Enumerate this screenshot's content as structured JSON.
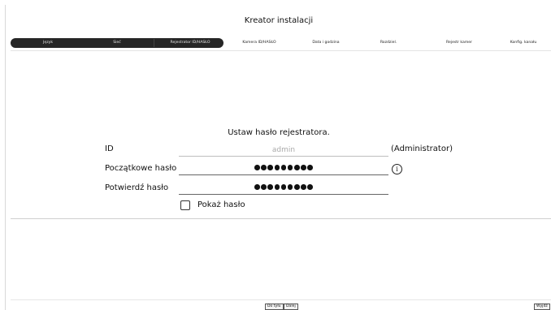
{
  "window": {
    "title": "Kreator instalacji"
  },
  "steps": [
    {
      "label": "Język",
      "state": "done"
    },
    {
      "label": "Sieć",
      "state": "done"
    },
    {
      "label": "Rejestrator ID/HASŁO",
      "state": "current"
    },
    {
      "label": "Kamera ID/HASŁO",
      "state": "todo"
    },
    {
      "label": "Data i godzina",
      "state": "todo"
    },
    {
      "label": "Rozdziel.",
      "state": "todo"
    },
    {
      "label": "Rejestr kamer",
      "state": "todo"
    },
    {
      "label": "Konfig. kanału",
      "state": "todo"
    }
  ],
  "form": {
    "heading": "Ustaw hasło rejestratora.",
    "id_label": "ID",
    "id_value": "admin",
    "id_note": "(Administrator)",
    "initial_password_label": "Początkowe hasło",
    "confirm_password_label": "Potwierdź hasło",
    "show_password_label": "Pokaż hasło",
    "show_password_checked": false,
    "masked_length": 9
  },
  "footer": {
    "back_label": "Do tyłu",
    "next_label": "Dalej",
    "exit_label": "Wyjdź"
  },
  "icons": {
    "info": "info-icon",
    "checkbox": "checkbox-icon"
  }
}
